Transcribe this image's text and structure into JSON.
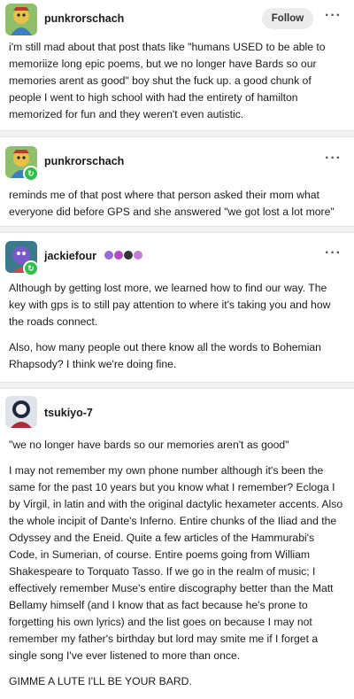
{
  "posts": [
    {
      "username": "punkrorschach",
      "follow_label": "Follow",
      "more_label": "···",
      "paragraphs": [
        "i'm still mad about that post thats like \"humans USED to be able to memoriize long epic poems, but we no longer have Bards so our memories arent as good\" boy shut the fuck up. a good chunk of people I went to high school with had the entirety of hamilton memorized for fun and they weren't even autistic."
      ]
    },
    {
      "username": "punkrorschach",
      "more_label": "···",
      "paragraphs": [
        "reminds me of that post where that person asked their mom what everyone did before GPS and she answered \"we got lost a lot more\""
      ]
    },
    {
      "username": "jackiefour",
      "more_label": "···",
      "paragraphs": [
        "Although by getting lost more, we learned how to find our way. The key with gps is to still pay attention to where it's taking you and how the roads connect.",
        "Also, how many people out there know all the words to Bohemian Rhapsody? I think we're doing fine."
      ]
    },
    {
      "username": "tsukiyo-7",
      "paragraphs": [
        "\"we no longer have bards so our memories aren't as good\"",
        "I may not remember my own phone number although it's been the same for the past 10 years but you know what I remember? Ecloga I by Virgil, in latin and with the original dactylic hexameter accents. Also the whole incipit of Dante's Inferno. Entire chunks of the Iliad and the Odyssey and the Eneid. Quite a few articles of the Hammurabi's Code, in Sumerian, of course. Entire poems going from William Shakespeare to Torquato Tasso. If we go in the realm of music; I effectively remember Muse's entire discography better than the Matt Bellamy himself (and I know that as fact because he's prone to forgetting his own lyrics) and the list goes on because I may not remember my father's birthday but lord may smite me if I forget a single song I've ever listened to more than once.",
        "GIMME A LUTE I'LL BE YOUR BARD."
      ]
    }
  ],
  "colors": {
    "badge_green": "#2fbf4a",
    "divider": "#f1f1f1",
    "follow_bg": "#ececec"
  }
}
